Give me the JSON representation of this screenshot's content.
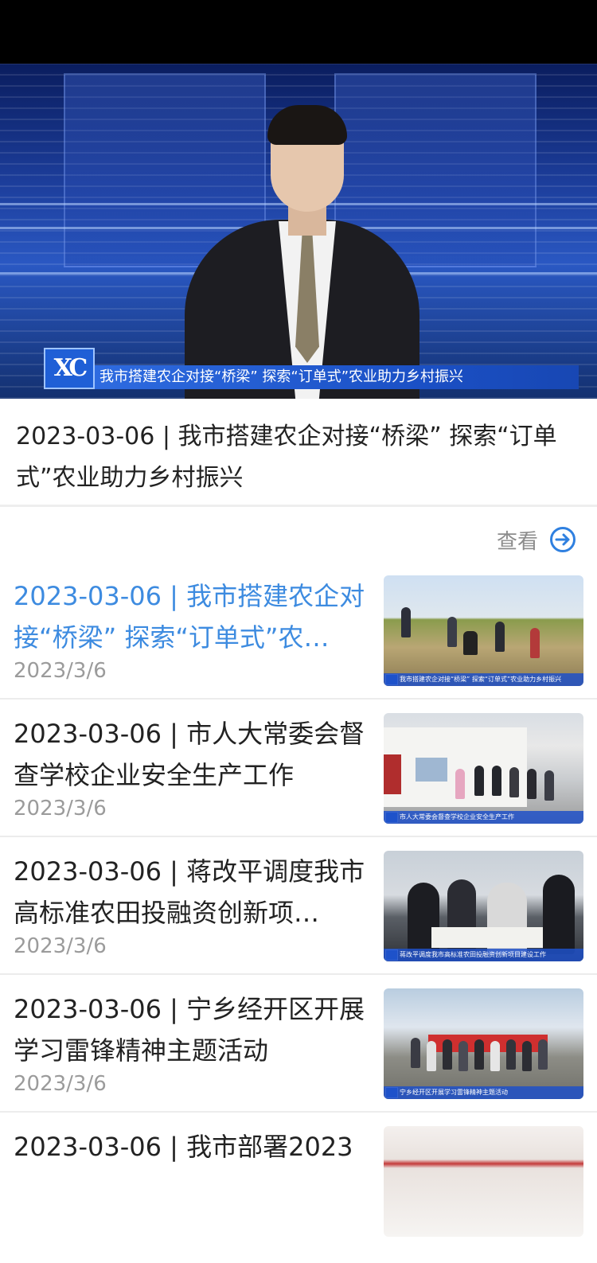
{
  "video": {
    "logo_text": "XC",
    "caption": "我市搭建农企对接“桥梁”   探索“订单式”农业助力乡村振兴"
  },
  "article": {
    "title": "2023-03-06 | 我市搭建农企对接“桥梁” 探索“订单式”农业助力乡村振兴"
  },
  "view_more": {
    "label": "查看",
    "icon": "arrow-right-circle-icon"
  },
  "colors": {
    "active_title": "#3d8be0",
    "date": "#9b9b9b",
    "text": "#222222"
  },
  "news": [
    {
      "title": "2023-03-06 | 我市搭建农企对接“桥梁” 探索“订单式”农…",
      "date": "2023/3/6",
      "caption": "我市搭建农企对接“桥梁”  探索“订单式”农业助力乡村振兴"
    },
    {
      "title": "2023-03-06 | 市人大常委会督查学校企业安全生产工作",
      "date": "2023/3/6",
      "caption": "市人大常委会督查学校企业安全生产工作"
    },
    {
      "title": "2023-03-06 | 蒋改平调度我市高标准农田投融资创新项…",
      "date": "2023/3/6",
      "caption": "蒋改平调度我市高标准农田投融资创新项目建设工作"
    },
    {
      "title": "2023-03-06 | 宁乡经开区开展学习雷锋精神主题活动",
      "date": "2023/3/6",
      "caption": "宁乡经开区开展学习雷锋精神主题活动"
    },
    {
      "title": "2023-03-06 | 我市部署2023",
      "date": "",
      "caption": ""
    }
  ]
}
